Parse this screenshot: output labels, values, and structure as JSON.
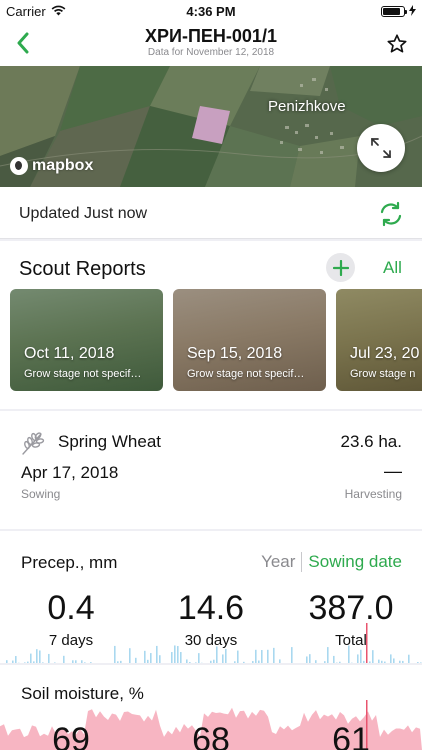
{
  "status_bar": {
    "carrier": "Carrier",
    "time": "4:36 PM",
    "battery_level": 0.85
  },
  "nav": {
    "title": "ХРИ-ПЕН-001/1",
    "subtitle": "Data for November 12, 2018",
    "back_icon": "chevron-left-icon",
    "favorite_icon": "star-outline-icon"
  },
  "map": {
    "place_label": "Penizhkove",
    "logo_text": "mapbox",
    "expand_icon": "expand-arrows-icon"
  },
  "updated": {
    "text": "Updated Just now",
    "refresh_icon": "refresh-icon"
  },
  "scout": {
    "title": "Scout Reports",
    "all_label": "All",
    "add_icon": "plus-icon",
    "cards": [
      {
        "date": "Oct 11, 2018",
        "stage": "Grow stage not specif…"
      },
      {
        "date": "Sep 15, 2018",
        "stage": "Grow stage not specif…"
      },
      {
        "date": "Jul 23, 20",
        "stage": "Grow stage n"
      }
    ]
  },
  "crop": {
    "name": "Spring Wheat",
    "area": "23.6 ha.",
    "sowing_date": "Apr 17, 2018",
    "harvest_date": "—",
    "sowing_label": "Sowing",
    "harvest_label": "Harvesting"
  },
  "precip": {
    "title": "Precep., mm",
    "year_label": "Year",
    "sowing_label": "Sowing date",
    "stats": [
      {
        "value": "0.4",
        "label": "7 days"
      },
      {
        "value": "14.6",
        "label": "30 days"
      },
      {
        "value": "387.0",
        "label": "Total"
      }
    ]
  },
  "soil": {
    "title": "Soil moisture, %",
    "values": [
      "69",
      "68",
      "61"
    ]
  },
  "colors": {
    "accent": "#2eaa4e",
    "precip_chart": "#a9d8ef",
    "soil_chart": "#f5a3b3",
    "marker": "#e8546e"
  }
}
